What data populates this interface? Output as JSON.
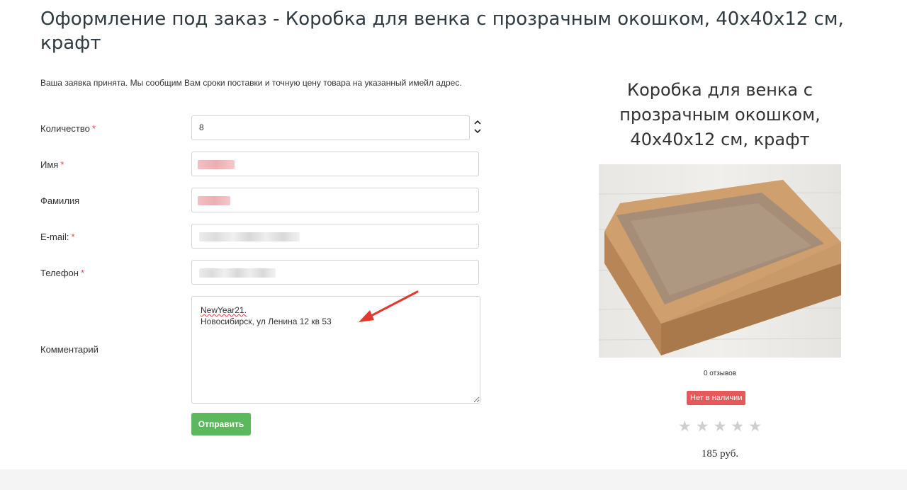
{
  "page": {
    "title": "Оформление под заказ - Коробка для венка с прозрачным окошком, 40х40х12 см, крафт",
    "notice": "Ваша заявка принята. Мы сообщим Вам сроки поставки и точную цену товара на указанный имейл адрес."
  },
  "form": {
    "quantity": {
      "label": "Количество",
      "value": "8"
    },
    "first_name": {
      "label": "Имя"
    },
    "last_name": {
      "label": "Фамилия"
    },
    "email": {
      "label": "E-mail:"
    },
    "phone": {
      "label": "Телефон"
    },
    "comment": {
      "label": "Комментарий",
      "line1": "NewYear21.",
      "line2": "Новосибирск, ул Ленина 12 кв 53"
    },
    "required_mark": "*",
    "submit_label": "Отправить"
  },
  "product": {
    "title": "Коробка для венка с прозрачным окошком, 40х40х12 см, крафт",
    "reviews": "0 отзывов",
    "availability": "Нет в наличии",
    "rating_stars": 0,
    "rating_max": 5,
    "star_glyphs": "★★★★★",
    "price": "185 руб."
  },
  "colors": {
    "required": "#e0484b",
    "submit": "#5cb85c",
    "out_of_stock": "#e8585a",
    "annotation_arrow": "#e2392f"
  }
}
